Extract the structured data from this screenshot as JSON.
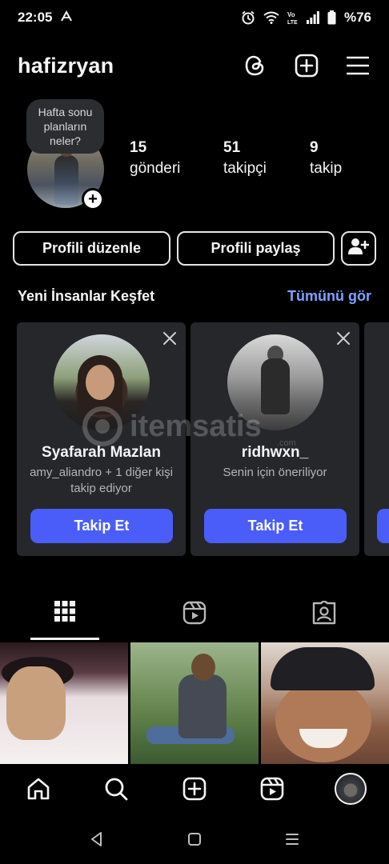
{
  "status_bar": {
    "time": "22:05",
    "battery": "%76",
    "icons": [
      "app-notification-icon",
      "alarm-icon",
      "wifi-icon",
      "volte-icon",
      "signal-icon",
      "battery-icon"
    ]
  },
  "header": {
    "username": "hafizryan",
    "icons": [
      "threads-icon",
      "create-post-icon",
      "menu-icon"
    ]
  },
  "profile": {
    "note": "Hafta sonu planların neler?",
    "stats": [
      {
        "value": "15",
        "label": "gönderi"
      },
      {
        "value": "51",
        "label": "takipçi"
      },
      {
        "value": "9",
        "label": "takip"
      }
    ]
  },
  "actions": {
    "edit_profile": "Profili düzenle",
    "share_profile": "Profili paylaş"
  },
  "discover": {
    "title": "Yeni İnsanlar Keşfet",
    "see_all": "Tümünü gör",
    "cards": [
      {
        "name": "Syafarah Mazlan",
        "subtitle": "amy_aliandro + 1 diğer kişi takip ediyor",
        "follow_label": "Takip Et"
      },
      {
        "name": "ridhwxn_",
        "subtitle": "Senin için öneriliyor",
        "follow_label": "Takip Et"
      }
    ]
  },
  "watermark": {
    "text": "itemsatis",
    "domain": ".com"
  },
  "tabs": {
    "active": "grid",
    "items": [
      "grid-icon",
      "reels-icon",
      "tagged-icon"
    ]
  },
  "bottom_nav": {
    "items": [
      "home-icon",
      "search-icon",
      "create-icon",
      "reels-icon",
      "profile-avatar"
    ]
  },
  "colors": {
    "background": "#000000",
    "card": "#26272b",
    "accent_button": "#4a5df9",
    "link": "#7ea2ff"
  }
}
